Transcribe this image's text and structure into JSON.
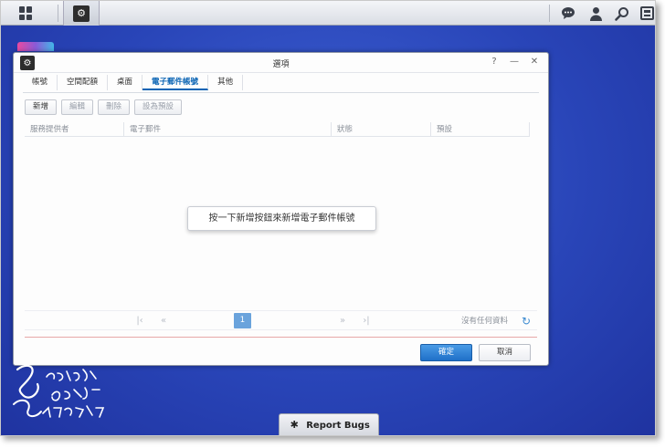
{
  "window": {
    "title": "選項",
    "tabs": [
      "帳號",
      "空間配額",
      "桌面",
      "電子郵件帳號",
      "其他"
    ],
    "active_tab": 3,
    "toolbar": {
      "add": "新增",
      "edit": "編輯",
      "delete": "刪除",
      "set_default": "設為預設"
    },
    "columns": [
      "服務提供者",
      "電子郵件",
      "狀態",
      "預設"
    ],
    "empty_message": "按一下新增按鈕來新增電子郵件帳號",
    "pager": {
      "page": "1",
      "status": "沒有任何資料"
    },
    "ok_label": "確定",
    "cancel_label": "取消",
    "help_glyph": "?",
    "minimize_glyph": "—",
    "close_glyph": "✕"
  },
  "report_bugs": "Report Bugs",
  "icons": {
    "main_menu": "grid-icon",
    "app": "gears-icon",
    "chat": "chat-icon",
    "user": "user-icon",
    "search": "search-icon",
    "widgets": "widgets-icon"
  },
  "colors": {
    "desktop": "#2f4fc4",
    "accent": "#1f70c8",
    "active_tab": "#0a64b4"
  }
}
